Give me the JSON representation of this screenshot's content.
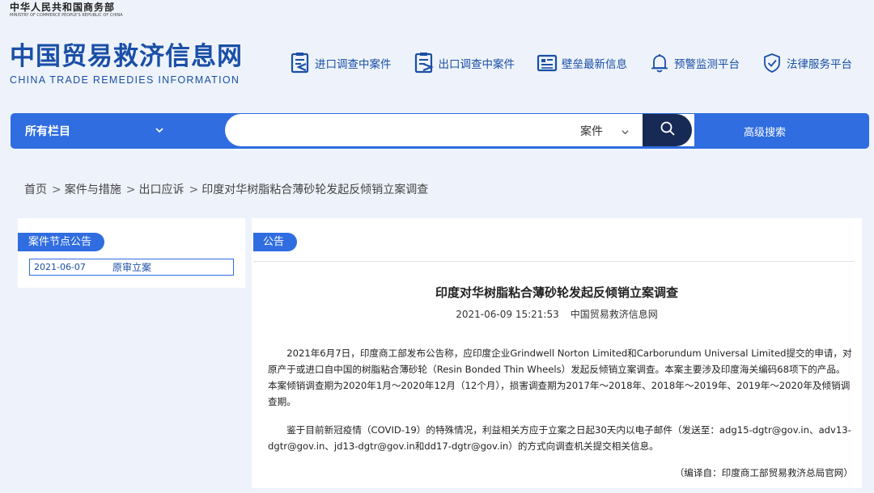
{
  "ministry": {
    "name": "中华人民共和国商务部",
    "name_en": "MINISTRY OF COMMERCE PEOPLE'S REPUBLIC OF CHINA"
  },
  "brand": {
    "title": "中国贸易救济信息网",
    "subtitle": "CHINA TRADE REMEDIES INFORMATION"
  },
  "topnav": [
    {
      "label": "进口调查中案件",
      "icon": "import-document-icon"
    },
    {
      "label": "出口调查中案件",
      "icon": "export-document-icon"
    },
    {
      "label": "壁垒最新信息",
      "icon": "news-list-icon"
    },
    {
      "label": "预警监测平台",
      "icon": "bell-icon"
    },
    {
      "label": "法律服务平台",
      "icon": "shield-check-icon"
    }
  ],
  "search": {
    "category": "所有栏目",
    "placeholder": "",
    "type": "案件",
    "advanced": "高级搜索"
  },
  "breadcrumb": [
    "首页",
    "案件与措施",
    "出口应诉",
    "印度对华树脂粘合薄砂轮发起反倾销立案调查"
  ],
  "side": {
    "title": "案件节点公告",
    "items": [
      {
        "date": "2021-06-07",
        "label": "原审立案"
      }
    ]
  },
  "article": {
    "section": "公告",
    "title": "印度对华树脂粘合薄砂轮发起反倾销立案调查",
    "datetime": "2021-06-09 15:21:53",
    "source": "中国贸易救济信息网",
    "paragraphs": [
      "2021年6月7日，印度商工部发布公告称，应印度企业Grindwell Norton Limited和Carborundum Universal Limited提交的申请，对原产于或进口自中国的树脂粘合薄砂轮（Resin Bonded Thin Wheels）发起反倾销立案调查。本案主要涉及印度海关编码68项下的产品。本案倾销调查期为2020年1月～2020年12月（12个月），损害调查期为2017年～2018年、2018年～2019年、2019年～2020年及倾销调查期。",
      "鉴于目前新冠疫情（COVID-19）的特殊情况，利益相关方应于立案之日起30天内以电子邮件（发送至：adg15-dgtr@gov.in、adv13-dgtr@gov.in、jd13-dgtr@gov.in和dd17-dgtr@gov.in）的方式向调查机关提交相关信息。"
    ],
    "footer": "（编译自：印度商工部贸易救济总局官网）"
  },
  "colors": {
    "brand_blue": "#1a4fa6",
    "accent_blue": "#2f6de0",
    "search_dark": "#172a55",
    "page_bg": "#eef3fb"
  }
}
